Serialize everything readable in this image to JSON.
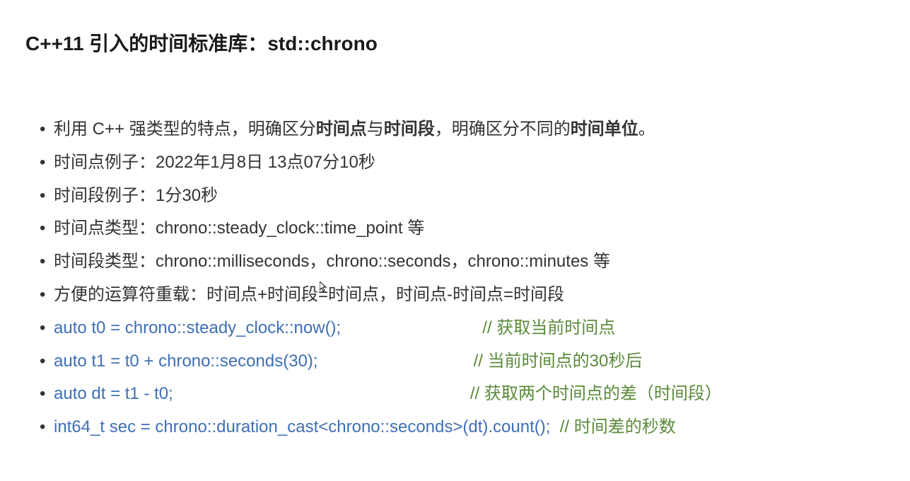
{
  "title_parts": {
    "prefix": "C++11 引入的时间标准库：",
    "suffix": "std::chrono"
  },
  "bullets": {
    "b1": {
      "p1": "利用 C++ 强类型的特点，明确区分",
      "p2": "时间点",
      "p3": "与",
      "p4": "时间段",
      "p5": "，明确区分不同的",
      "p6": "时间单位",
      "p7": "。"
    },
    "b2": "时间点例子：2022年1月8日 13点07分10秒",
    "b3": "时间段例子：1分30秒",
    "b4": "时间点类型：chrono::steady_clock::time_point 等",
    "b5": "时间段类型：chrono::milliseconds，chrono::seconds，chrono::minutes 等",
    "b6": "方便的运算符重载：时间点+时间段=时间点，时间点-时间点=时间段",
    "c1": {
      "code": "auto t0 = chrono::steady_clock::now();",
      "pad": "                              ",
      "comment": "// 获取当前时间点"
    },
    "c2": {
      "code": "auto t1 = t0 + chrono::seconds(30);",
      "pad": "                                 ",
      "comment": "// 当前时间点的30秒后"
    },
    "c3": {
      "code": "auto dt = t1 - t0;",
      "pad": "                                                               ",
      "comment": "// 获取两个时间点的差（时间段）"
    },
    "c4": {
      "code": "int64_t sec = chrono::duration_cast<chrono::seconds>(dt).count();",
      "pad": "  ",
      "comment": "// 时间差的秒数"
    }
  }
}
